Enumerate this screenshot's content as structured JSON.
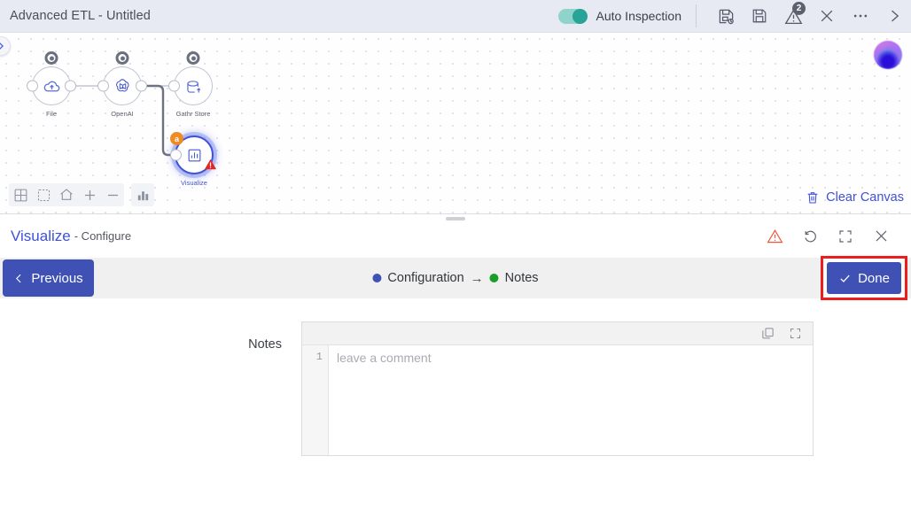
{
  "topbar": {
    "app_title": "Advanced ETL - Untitled",
    "auto_inspection_label": "Auto Inspection",
    "toggle_state": "on",
    "icons": [
      {
        "name": "save-as-icon",
        "label": "Save As"
      },
      {
        "name": "save-icon",
        "label": "Save"
      },
      {
        "name": "warning-icon",
        "label": "Inspection Errors",
        "badge": "2"
      },
      {
        "name": "close-icon",
        "label": "Close"
      },
      {
        "name": "more-options-icon",
        "label": "More"
      },
      {
        "name": "chevron-right-icon",
        "label": "Next"
      }
    ]
  },
  "canvas": {
    "nodes": [
      {
        "id": "file",
        "label": "File",
        "icon": "cloud-upload-icon",
        "selected": false
      },
      {
        "id": "openai",
        "label": "OpenAI",
        "icon": "openai-icon",
        "selected": false
      },
      {
        "id": "gathr-store",
        "label": "Gathr Store",
        "icon": "storage-upload-icon",
        "selected": false
      },
      {
        "id": "visualize",
        "label": "Visualize",
        "icon": "chart-icon",
        "selected": true,
        "lock_badge": "a",
        "warning": true
      }
    ],
    "tools": [
      {
        "name": "grid-view-icon",
        "label": "Grid"
      },
      {
        "name": "marquee-select-icon",
        "label": "Select"
      },
      {
        "name": "home-icon",
        "label": "Reset View"
      },
      {
        "name": "zoom-in-icon",
        "label": "Zoom In"
      },
      {
        "name": "zoom-out-icon",
        "label": "Zoom Out"
      },
      {
        "name": "bar-chart-icon",
        "label": "Statistics"
      }
    ],
    "clear_canvas_label": "Clear Canvas",
    "expand_tab_label": "Expand Panel"
  },
  "panel": {
    "title": "Visualize",
    "subtitle": "- Configure",
    "head_icons": [
      {
        "name": "warning-icon",
        "label": "Errors"
      },
      {
        "name": "reset-icon",
        "label": "Reset"
      },
      {
        "name": "fullscreen-icon",
        "label": "Maximize"
      },
      {
        "name": "close-icon",
        "label": "Close"
      }
    ],
    "previous_label": "Previous",
    "done_label": "Done",
    "breadcrumb": [
      {
        "label": "Configuration",
        "color": "#3f51b5"
      },
      {
        "label": "Notes",
        "color": "#1a9e2a"
      }
    ],
    "breadcrumb_arrow": "→",
    "form": {
      "notes_label": "Notes",
      "notes_line_number": "1",
      "notes_placeholder": "leave a comment",
      "notes_value": "",
      "editor_icons": [
        {
          "name": "copy-icon",
          "label": "Copy"
        },
        {
          "name": "fullscreen-icon",
          "label": "Expand"
        }
      ]
    }
  },
  "colors": {
    "accent_blue": "#3f51b5",
    "link_blue": "#3f51d8",
    "toggle_teal": "#28a396",
    "warning_red": "#ee1d1d",
    "lock_orange": "#f08a24",
    "topbar_bg": "#e8eaf3"
  }
}
